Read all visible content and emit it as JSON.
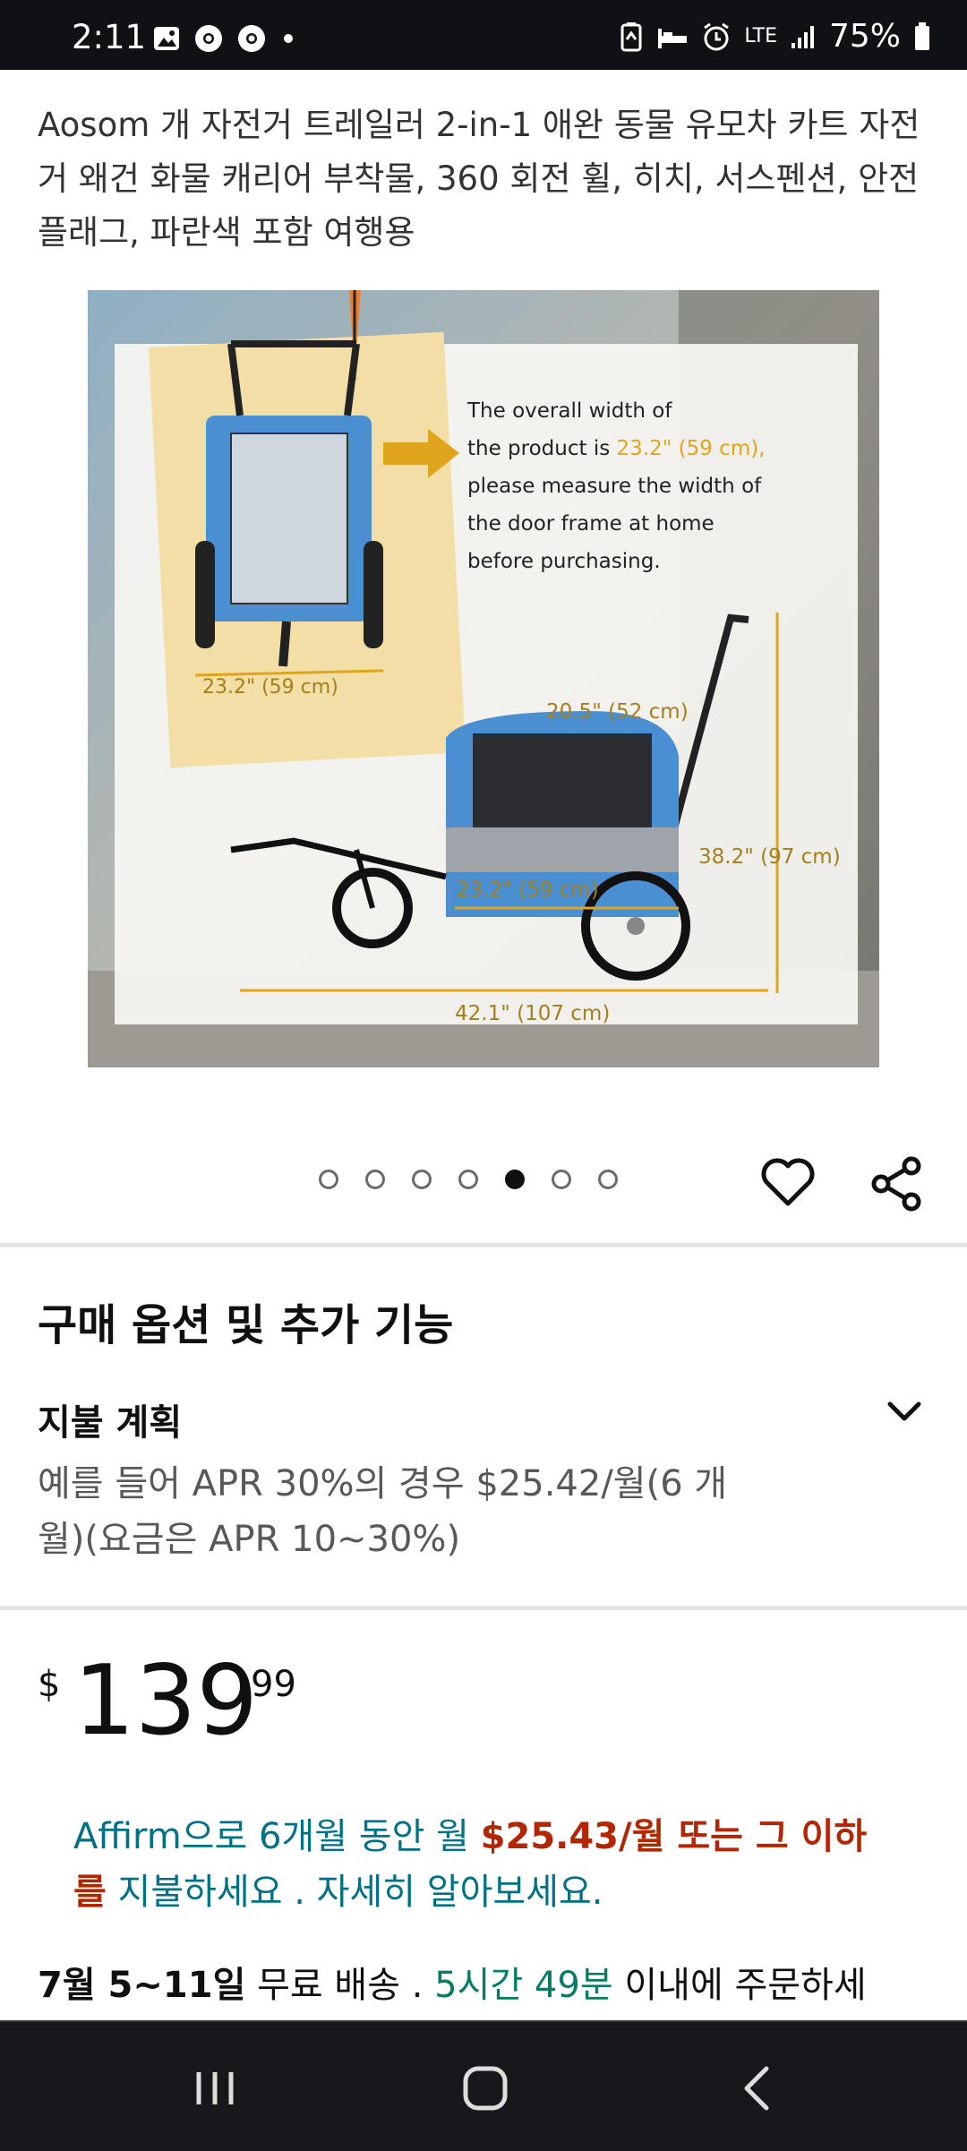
{
  "status_bar": {
    "time": "2:11",
    "network": "LTE",
    "battery": "75%"
  },
  "product": {
    "title": "Aosom 개 자전거 트레일러 2-in-1 애완 동물 유모차 카트 자전거 왜건 화물 캐리어 부착물, 360 회전 휠, 히치, 서스펜션, 안전 플래그, 파란색 포함 여행용"
  },
  "image": {
    "caption_line1": "The overall width of",
    "caption_line2a": "the product is ",
    "caption_line2b": "23.2\" (59 cm),",
    "caption_line3": "please measure the width of",
    "caption_line4": "the door frame at home",
    "caption_line5": "before purchasing.",
    "dim_width_front": "23.2\" (59 cm)",
    "dim_depth": "20.5\" (52 cm)",
    "dim_width_side": "23.2\" (59 cm)",
    "dim_height": "38.2\" (97 cm)",
    "dim_length": "42.1\" (107 cm)"
  },
  "carousel": {
    "total": 7,
    "active": 5
  },
  "options": {
    "section_title": "구매 옵션 및 추가 기능",
    "payment_plan_title": "지불 계획",
    "payment_plan_desc": "예를 들어 APR 30%의 경우 $25.42/월(6 개월)(요금은 APR 10~30%)"
  },
  "price": {
    "currency": "$",
    "whole": "139",
    "fraction": "99"
  },
  "affirm": {
    "part1": "Affirm으로 6개월 동안 월 ",
    "highlight": "$25.43/월 또는 그 이하를",
    "part2": " 지불하세요 . 자세히 알아보세요."
  },
  "delivery": {
    "date": "7월 5~11일",
    "text1": " 무료 배송 . ",
    "countdown": "5시간 49분",
    "text2": " 이내에 주문하세"
  },
  "colors": {
    "status_bar_bg": "#0f1114",
    "link_teal": "#007185",
    "price_red": "#b12704",
    "green": "#067d62",
    "accent_gold": "#e0a51c"
  }
}
